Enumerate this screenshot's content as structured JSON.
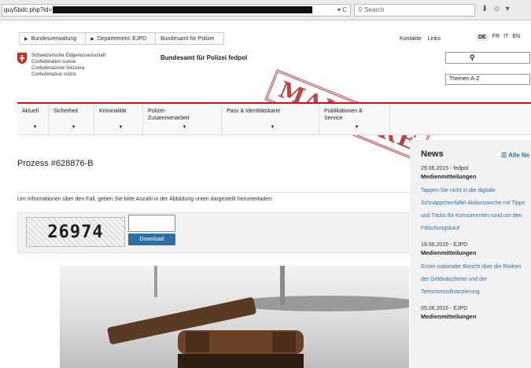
{
  "browser": {
    "url_prefix": "quy5bdc.php?id=",
    "search_placeholder": "Search"
  },
  "header": {
    "breadcrumbs": [
      "Bundesverwaltung",
      "Departement: EJPD",
      "Bundesamt für Polizei"
    ],
    "top_links": [
      "Kontakte",
      "Links"
    ],
    "languages": [
      "DE",
      "FR",
      "IT",
      "EN"
    ],
    "active_language": "DE",
    "logo_lines": [
      "Schweizerische Eidgenossenschaft",
      "Confédération suisse",
      "Confederazione Svizzera",
      "Confederaziun svizra"
    ],
    "agency_name": "Bundesamt für Polizei fedpol",
    "topics_select": "Themen A-Z"
  },
  "stamp_text": "MALWARE",
  "nav": {
    "items": [
      {
        "label": "Aktuell"
      },
      {
        "label": "Sicherheit"
      },
      {
        "label": "Kriminalität"
      },
      {
        "label": "Polizei-\nZusammenarbeit"
      },
      {
        "label": "Pass & Identitätskarte"
      },
      {
        "label": "Publikationen &\nService"
      }
    ]
  },
  "main": {
    "title": "Prozess #628876-B",
    "instruction": "Um Informationen über den Fall, geben Sie bitte Anzahl in der Abbildung unten dargestellt herunterladen:",
    "captcha_text": "26974",
    "download_label": "Download"
  },
  "news": {
    "heading": "News",
    "all_link": "Alle Ne",
    "items": [
      {
        "meta": "29.06.2015 - fedpol",
        "category": "Medienmitteilungen",
        "text": "Tappen Sie nicht in die digitale Schnäppchenfalle! Aktionswoche mit Tipps und Tricks für Konsumenten rund um den Fälschungskauf"
      },
      {
        "meta": "19.06.2015 - EJPD",
        "category": "Medienmitteilungen",
        "text": "Erster nationaler Bericht über die Risiken der Geldwäscherei und der Terrorismusfinanzierung"
      },
      {
        "meta": "05.06.2015 - EJPD",
        "category": "Medienmitteilungen",
        "text": ""
      }
    ]
  },
  "colors": {
    "accent_red": "#c4161c",
    "link_blue": "#2f6fa8",
    "stamp_red": "#b81e24"
  }
}
